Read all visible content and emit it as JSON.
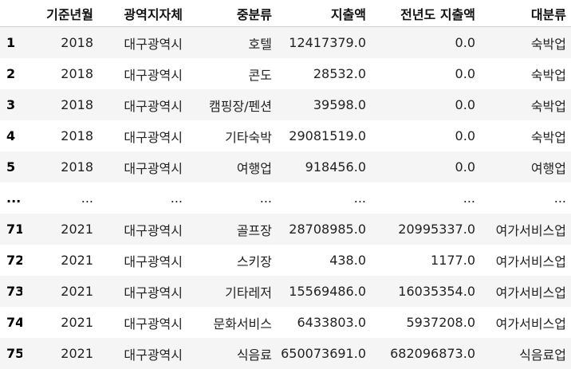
{
  "table": {
    "columns": [
      "",
      "기준년월",
      "광역지자체",
      "중분류",
      "지출액",
      "전년도 지출액",
      "대분류"
    ],
    "rows": [
      [
        "1",
        "2018",
        "대구광역시",
        "호텔",
        "12417379.0",
        "0.0",
        "숙박업"
      ],
      [
        "2",
        "2018",
        "대구광역시",
        "콘도",
        "28532.0",
        "0.0",
        "숙박업"
      ],
      [
        "3",
        "2018",
        "대구광역시",
        "캠핑장/펜션",
        "39598.0",
        "0.0",
        "숙박업"
      ],
      [
        "4",
        "2018",
        "대구광역시",
        "기타숙박",
        "29081519.0",
        "0.0",
        "숙박업"
      ],
      [
        "5",
        "2018",
        "대구광역시",
        "여행업",
        "918456.0",
        "0.0",
        "여행업"
      ],
      [
        "...",
        "...",
        "...",
        "...",
        "...",
        "...",
        "..."
      ],
      [
        "71",
        "2021",
        "대구광역시",
        "골프장",
        "28708985.0",
        "20995337.0",
        "여가서비스업"
      ],
      [
        "72",
        "2021",
        "대구광역시",
        "스키장",
        "438.0",
        "1177.0",
        "여가서비스업"
      ],
      [
        "73",
        "2021",
        "대구광역시",
        "기타레저",
        "15569486.0",
        "16035354.0",
        "여가서비스업"
      ],
      [
        "74",
        "2021",
        "대구광역시",
        "문화서비스",
        "6433803.0",
        "5937208.0",
        "여가서비스업"
      ],
      [
        "75",
        "2021",
        "대구광역시",
        "식음료",
        "650073691.0",
        "682096873.0",
        "식음료업"
      ]
    ]
  }
}
